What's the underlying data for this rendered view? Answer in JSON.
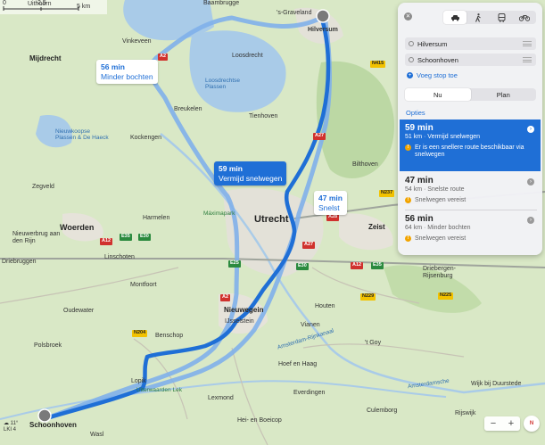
{
  "map": {
    "scale": {
      "zero": "0",
      "half": "2,5",
      "full": "5 km"
    },
    "labels": {
      "uithoorn": "Uithoorn",
      "baambrugge": "Baambrugge",
      "graveland": "'s-Graveland",
      "hilversum": "Hilversum",
      "mijdrecht": "Mijdrecht",
      "vinkeveen": "Vinkeveen",
      "loosdrecht": "Loosdrecht",
      "loosdrechtse_plassen": "Loosdrechtse Plassen",
      "breukelen": "Breukelen",
      "tienhoven": "Tienhoven",
      "nieuwkoopse_plassen": "Nieuwkoopse Plassen & De Haeck",
      "kockengen": "Kockengen",
      "bilthoven": "Bilthoven",
      "zegveld": "Zegveld",
      "maximapark": "Máximapark",
      "harmelen": "Harmelen",
      "utrecht": "Utrecht",
      "zeist": "Zeist",
      "nieuwerbrug": "Nieuwerbrug aan den Rijn",
      "woerden": "Woerden",
      "linschoten": "Linschoten",
      "driebruggen": "Driebruggen",
      "montfoort": "Montfoort",
      "driebergen": "Driebergen-Rijsenburg",
      "oudewater": "Oudewater",
      "nieuwegein": "Nieuwegein",
      "ijsselstein": "IJsselstein",
      "houten": "Houten",
      "benschop": "Benschop",
      "polsbroek": "Polsbroek",
      "t_goy": "'t Goy",
      "lopik": "Lopik",
      "hoef_en_haag": "Hoef en Haag",
      "uiterwaarden_lek": "Uiterwaarden Lek",
      "everdingen": "Everdingen",
      "wijk_bij_duurstede": "Wijk bij Duurstede",
      "lexmond": "Lexmond",
      "culemborg": "Culemborg",
      "rijswijk": "Rijswijk",
      "schoonhoven": "Schoonhoven",
      "vianen": "Vianen",
      "hei_en_boeicop": "Hei- en Boeicop",
      "amsterdam_rijnkanaal": "Amsterdam-Rijnkanaal",
      "amsterdamsche": "Amsterdamsche",
      "wasl": "Wasl"
    },
    "shields": {
      "a2_north": "A2",
      "a27_north": "A27",
      "n415": "N415",
      "n237": "N237",
      "a28": "A28",
      "a12_west": "A12",
      "e35": "E35",
      "e30_west": "E30",
      "a27_mid": "A27",
      "e30_mid": "E30",
      "a12_east": "A12",
      "e35_east": "E35",
      "e25": "E25",
      "a2_south": "A2",
      "n204": "N204",
      "n225": "N225",
      "n229": "N229"
    },
    "callouts": {
      "fast": {
        "time": "47 min",
        "label": "Snelst"
      },
      "selected": {
        "time": "59 min",
        "label": "Vermijd snelwegen"
      },
      "fewer_turns": {
        "time": "56 min",
        "label": "Minder bochten"
      }
    },
    "weather": {
      "temp": "11°",
      "aqi": "LKI 4"
    },
    "zoom": {
      "minus": "−",
      "plus": "+"
    },
    "compass": "N"
  },
  "panel": {
    "close_glyph": "✕",
    "waypoints": [
      "Hilversum",
      "Schoonhoven"
    ],
    "add_stop": "Voeg stop toe",
    "time_modes": {
      "now": "Nu",
      "plan": "Plan"
    },
    "options_label": "Opties",
    "routes": [
      {
        "time": "59 min",
        "desc": "51 km · Vermijd snelwegen",
        "warning": "Er is een snellere route beschikbaar via snelwegen"
      },
      {
        "time": "47 min",
        "desc": "54 km · Snelste route",
        "warning": "Snelwegen vereist"
      },
      {
        "time": "56 min",
        "desc": "64 km · Minder bochten",
        "warning": "Snelwegen vereist"
      }
    ]
  },
  "colors": {
    "route_selected": "#1f6fd6",
    "route_alt": "#7fb0ea",
    "water": "#a9cbe8",
    "land": "#d9e8c6"
  }
}
